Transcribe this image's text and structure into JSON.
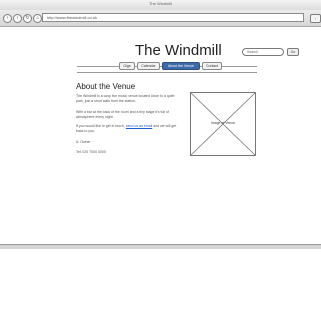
{
  "window": {
    "title": "The Windmill"
  },
  "toolbar": {
    "back_icon": "back-arrow-icon",
    "forward_icon": "forward-arrow-icon",
    "reload_icon": "reload-icon",
    "home_icon": "home-icon",
    "url": "http://www.thewindmill.co.uk"
  },
  "site": {
    "title": "The Windmill",
    "search_placeholder": "Search",
    "search_button": "Go"
  },
  "nav": {
    "tabs": [
      {
        "label": "Gigs",
        "active": false
      },
      {
        "label": "Calendar",
        "active": false
      },
      {
        "label": "About the Venue",
        "active": true
      },
      {
        "label": "Contact",
        "active": false
      }
    ]
  },
  "main": {
    "heading": "About the Venue",
    "paragraphs": [
      "The Windmill is a cosy live music venue located close to a quiet park, just a short walk from the station.",
      "With a bar at the back of the room and a tiny stage it's full of atmosphere every night.",
      "If you would like to get in touch, send us an email and we will get back to you.",
      "A. Owner",
      "Tel: 020 7000 0000"
    ],
    "link_text": "send us an email",
    "image_caption": "Image of Venue"
  }
}
